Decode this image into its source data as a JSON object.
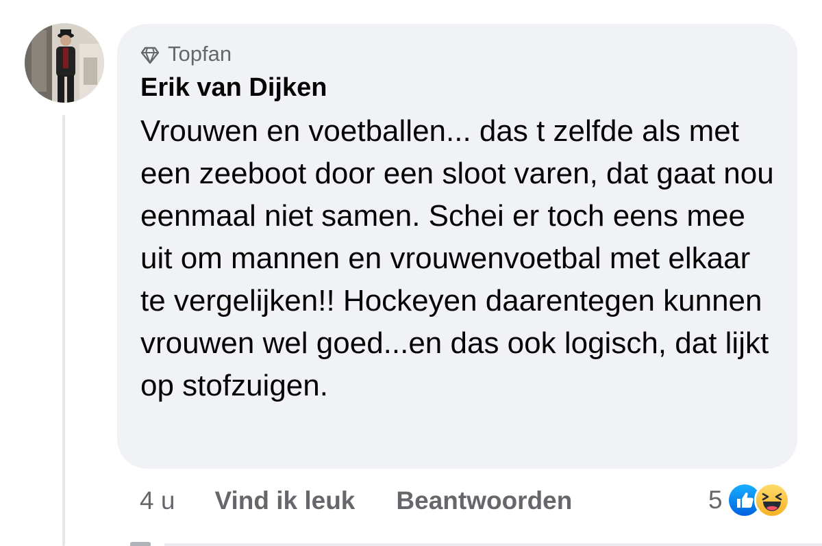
{
  "comment": {
    "badge_label": "Topfan",
    "badge_icon": "diamond-icon",
    "author_name": "Erik van Dijken",
    "text": "Vrouwen en voetballen... das t zelfde als met een zeeboot door een sloot varen, dat gaat nou eenmaal niet samen. Schei er toch eens mee uit om mannen en vrouwenvoetbal met elkaar te vergelijken!! Hockeyen daarentegen kunnen vrouwen wel goed...en das ook logisch, dat lijkt op stofzuigen.",
    "timestamp": "4 u",
    "like_label": "Vind ik leuk",
    "reply_label": "Beantwoorden",
    "reaction_count": "5",
    "reaction_icons": [
      "like-icon",
      "haha-icon"
    ]
  },
  "colors": {
    "bubble_bg": "#f0f2f5",
    "secondary_text": "#65676b",
    "primary_text": "#050505",
    "like_blue": "#1877f2",
    "haha_yellow": "#f7b125"
  }
}
